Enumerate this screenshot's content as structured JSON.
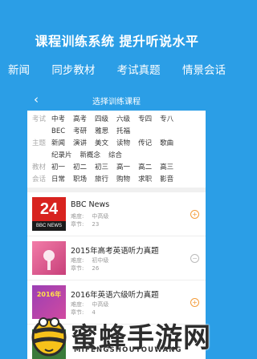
{
  "hero": {
    "title": "课程训练系统 提升听说水平",
    "subtitle": [
      "新闻",
      "同步教材",
      "考试真题",
      "情景会话"
    ]
  },
  "nav": {
    "back_icon": "chevron-left-icon",
    "title": "选择训练课程"
  },
  "filters": [
    {
      "label": "考试",
      "options": [
        "中考",
        "高考",
        "四级",
        "六级",
        "专四",
        "专八",
        "BEC",
        "考研",
        "雅思",
        "托福"
      ]
    },
    {
      "label": "主题",
      "options": [
        "新闻",
        "演讲",
        "美文",
        "读物",
        "传记",
        "歌曲",
        "纪录片",
        "新概念",
        "综合"
      ]
    },
    {
      "label": "教材",
      "options": [
        "初一",
        "初二",
        "初三",
        "高一",
        "高二",
        "高三"
      ]
    },
    {
      "label": "会话",
      "options": [
        "日常",
        "职场",
        "旅行",
        "购物",
        "求职",
        "影音"
      ]
    }
  ],
  "courses": [
    {
      "title": "BBC News",
      "difficulty_label": "难度:",
      "difficulty": "中高级",
      "chapters_label": "章节:",
      "chapters": "23",
      "action": "+",
      "thumb_text": "24",
      "thumb_caption": "BBC NEWS"
    },
    {
      "title": "2015年高考英语听力真题",
      "difficulty_label": "难度:",
      "difficulty": "初中级",
      "chapters_label": "章节:",
      "chapters": "26",
      "action": "−"
    },
    {
      "title": "2016年英语六级听力真题",
      "difficulty_label": "难度:",
      "difficulty": "中高级",
      "chapters_label": "章节:",
      "chapters": "4",
      "action": "+",
      "thumb_text": "2016年"
    }
  ],
  "watermark": {
    "name": "蜜蜂手游网",
    "sub": "MIFENGSHOUYOUWANG"
  },
  "colors": {
    "brand": "#2b9ee6",
    "accent": "#f39c3a"
  }
}
